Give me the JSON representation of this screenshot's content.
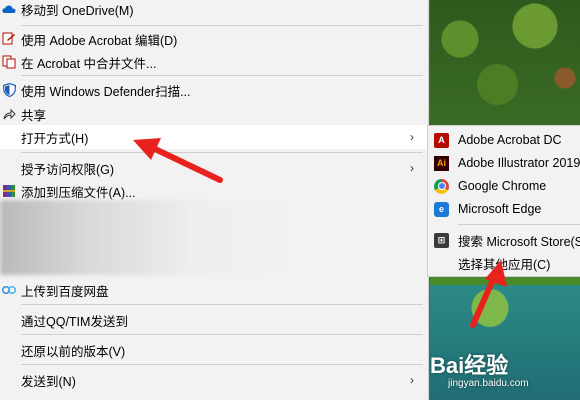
{
  "menu": {
    "items": [
      {
        "label": "移动到 OneDrive(M)",
        "icon": "onedrive-icon"
      },
      {
        "label": "使用 Adobe Acrobat 编辑(D)",
        "icon": "acrobat-edit-icon"
      },
      {
        "label": "在 Acrobat 中合并文件...",
        "icon": "acrobat-combine-icon"
      },
      {
        "label": "使用 Windows Defender扫描...",
        "icon": "defender-shield-icon"
      },
      {
        "label": "共享",
        "icon": "share-icon"
      },
      {
        "label": "打开方式(H)",
        "icon": "",
        "submenu": true,
        "highlighted": true
      },
      {
        "label": "授予访问权限(G)",
        "icon": "",
        "submenu": true
      },
      {
        "label": "添加到压缩文件(A)...",
        "icon": "winrar-icon"
      },
      {
        "label": "上传到百度网盘",
        "icon": "baidu-netdisk-icon"
      },
      {
        "label": "通过QQ/TIM发送到",
        "icon": ""
      },
      {
        "label": "还原以前的版本(V)",
        "icon": ""
      },
      {
        "label": "发送到(N)",
        "icon": "",
        "submenu": true
      }
    ]
  },
  "submenu": {
    "items": [
      {
        "label": "Adobe Acrobat DC",
        "icon": "adobe-acrobat-icon",
        "glyph": "A"
      },
      {
        "label": "Adobe Illustrator 2019",
        "icon": "adobe-illustrator-icon",
        "glyph": "Ai"
      },
      {
        "label": "Google Chrome",
        "icon": "chrome-icon",
        "glyph": ""
      },
      {
        "label": "Microsoft Edge",
        "icon": "edge-icon",
        "glyph": "e"
      },
      {
        "label": "搜索 Microsoft Store(S)",
        "icon": "store-icon",
        "glyph": "⊞"
      },
      {
        "label": "选择其他应用(C)",
        "icon": "",
        "glyph": ""
      }
    ]
  },
  "watermark": {
    "text": "Bai经验",
    "sub": "jingyan.baidu.com"
  },
  "colors": {
    "menu_bg": "#f2f2f2",
    "highlight": "#ffffff",
    "arrow": "#e8231f"
  }
}
